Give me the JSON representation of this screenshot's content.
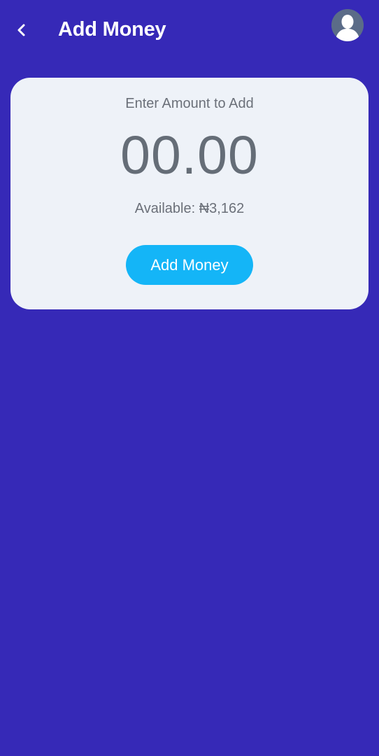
{
  "header": {
    "title": "Add Money"
  },
  "card": {
    "prompt": "Enter Amount to Add",
    "amount": "00.00",
    "available_label": "Available: ₦3,162",
    "button_label": "Add Money"
  },
  "icons": {
    "back": "chevron-left-icon",
    "avatar": "user-avatar-icon"
  },
  "colors": {
    "background": "#3629B7",
    "card": "#EEF2F8",
    "button": "#14B5F7",
    "text_muted": "#6b7079"
  }
}
